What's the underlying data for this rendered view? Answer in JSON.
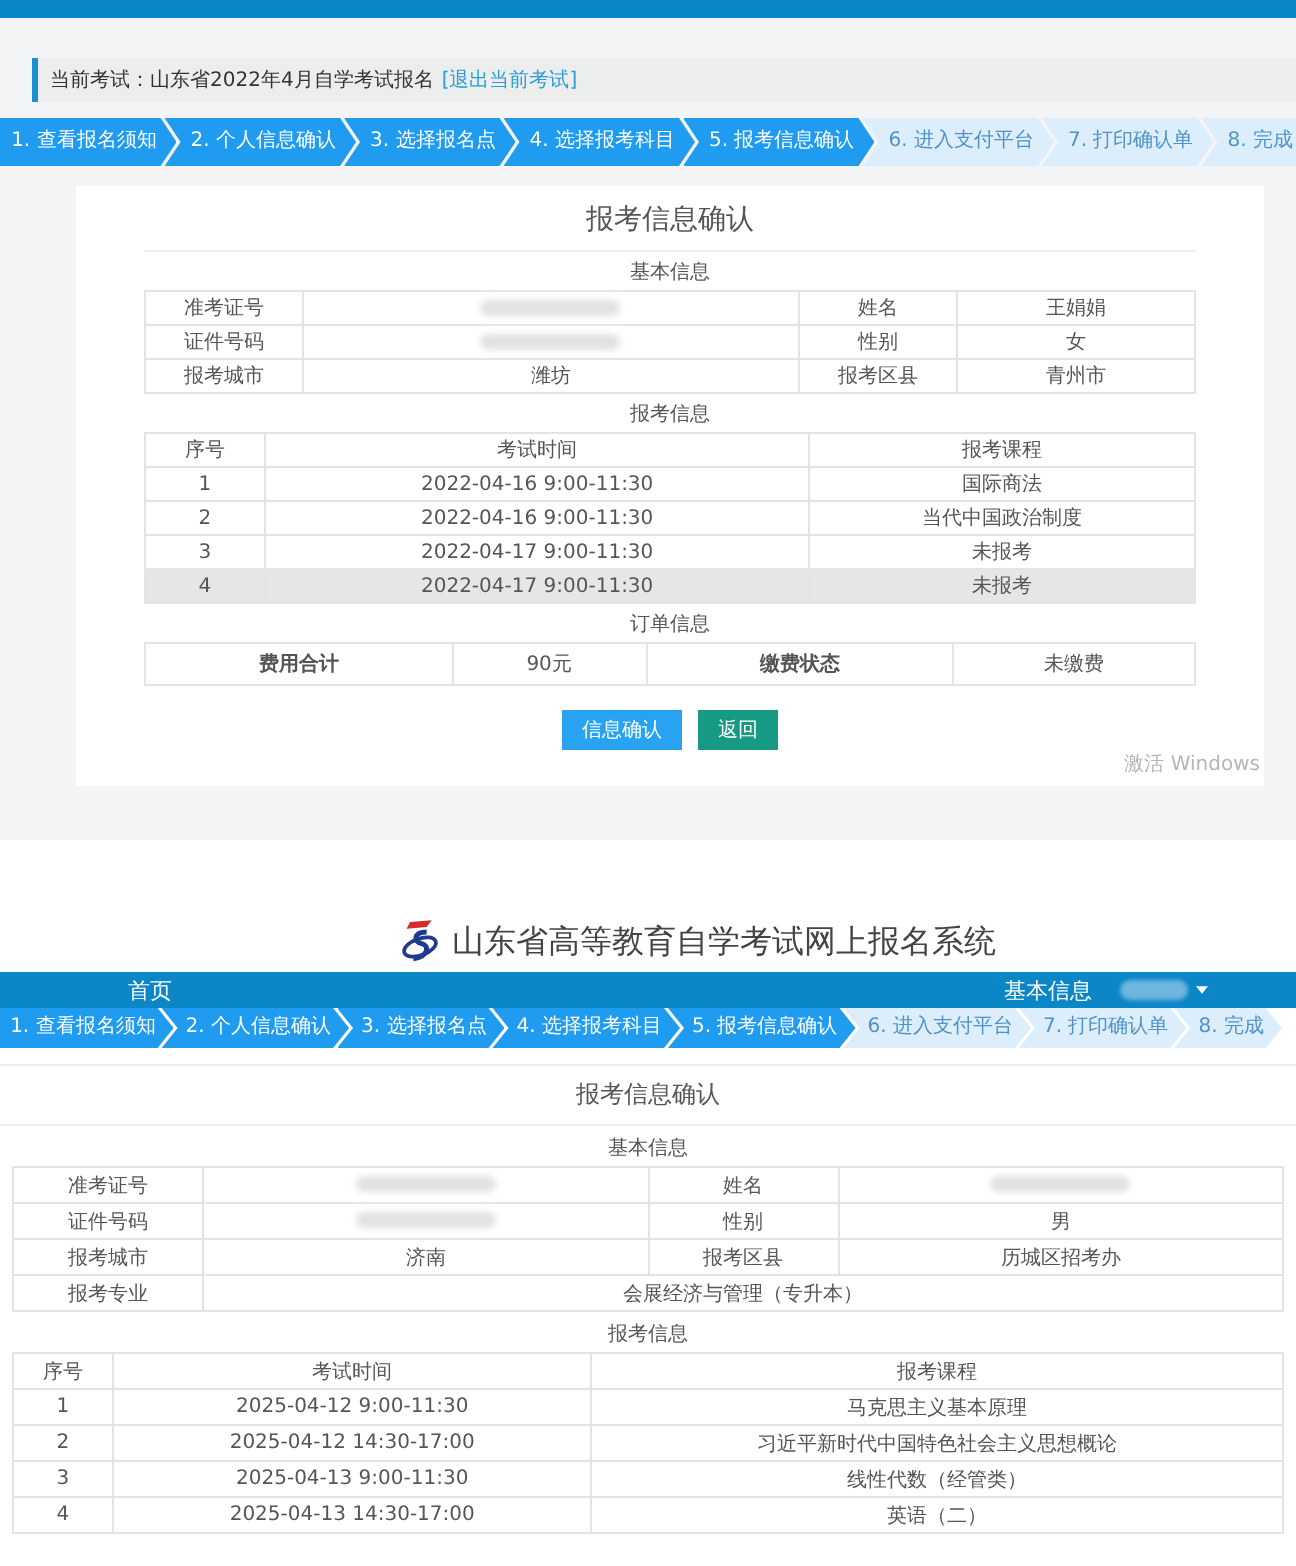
{
  "old_screen": {
    "current_exam": {
      "label": "当前考试：山东省2022年4月自学考试报名",
      "exit_link": "[退出当前考试]"
    },
    "steps": [
      {
        "label": "1. 查看报名须知",
        "done": true
      },
      {
        "label": "2. 个人信息确认",
        "done": true
      },
      {
        "label": "3. 选择报名点",
        "done": true
      },
      {
        "label": "4. 选择报考科目",
        "done": true
      },
      {
        "label": "5. 报考信息确认",
        "done": true
      },
      {
        "label": "6. 进入支付平台",
        "done": false
      },
      {
        "label": "7. 打印确认单",
        "done": false
      },
      {
        "label": "8. 完成",
        "done": false
      }
    ],
    "title": "报考信息确认",
    "basic_info": {
      "heading": "基本信息",
      "rows": [
        [
          {
            "kind": "label",
            "text": "准考证号"
          },
          {
            "kind": "redacted"
          },
          {
            "kind": "label",
            "text": "姓名"
          },
          {
            "kind": "value",
            "text": "王娟娟"
          }
        ],
        [
          {
            "kind": "label",
            "text": "证件号码"
          },
          {
            "kind": "redacted"
          },
          {
            "kind": "label",
            "text": "性别"
          },
          {
            "kind": "value",
            "text": "女"
          }
        ],
        [
          {
            "kind": "label",
            "text": "报考城市"
          },
          {
            "kind": "value",
            "text": "潍坊"
          },
          {
            "kind": "label",
            "text": "报考区县"
          },
          {
            "kind": "value",
            "text": "青州市"
          }
        ]
      ]
    },
    "exam_info": {
      "heading": "报考信息",
      "columns": [
        "序号",
        "考试时间",
        "报考课程"
      ],
      "rows": [
        {
          "cells": [
            "1",
            "2022-04-16 9:00-11:30",
            "国际商法"
          ],
          "selected": false
        },
        {
          "cells": [
            "2",
            "2022-04-16 9:00-11:30",
            "当代中国政治制度"
          ],
          "selected": false
        },
        {
          "cells": [
            "3",
            "2022-04-17 9:00-11:30",
            "未报考"
          ],
          "selected": false
        },
        {
          "cells": [
            "4",
            "2022-04-17 9:00-11:30",
            "未报考"
          ],
          "selected": true
        }
      ]
    },
    "order_info": {
      "heading": "订单信息",
      "cells": [
        "费用合计",
        "90元",
        "缴费状态",
        "未缴费"
      ]
    },
    "buttons": [
      {
        "label": "信息确认",
        "kind": "primary"
      },
      {
        "label": "返回",
        "kind": "secondary"
      }
    ],
    "os_notice": "激活 Windows"
  },
  "new_screen": {
    "site_title": "山东省高等教育自学考试网上报名系统",
    "nav": {
      "home": "首页",
      "account": "基本信息"
    },
    "steps": [
      {
        "label": "1. 查看报名须知",
        "done": true
      },
      {
        "label": "2. 个人信息确认",
        "done": true
      },
      {
        "label": "3. 选择报名点",
        "done": true
      },
      {
        "label": "4. 选择报考科目",
        "done": true
      },
      {
        "label": "5. 报考信息确认",
        "done": true
      },
      {
        "label": "6. 进入支付平台",
        "done": false
      },
      {
        "label": "7. 打印确认单",
        "done": false
      },
      {
        "label": "8. 完成",
        "done": false
      }
    ],
    "title": "报考信息确认",
    "basic_info": {
      "heading": "基本信息",
      "rows": [
        [
          {
            "kind": "label",
            "text": "准考证号"
          },
          {
            "kind": "redacted"
          },
          {
            "kind": "label",
            "text": "姓名"
          },
          {
            "kind": "redacted"
          }
        ],
        [
          {
            "kind": "label",
            "text": "证件号码"
          },
          {
            "kind": "redacted"
          },
          {
            "kind": "label",
            "text": "性别"
          },
          {
            "kind": "value",
            "text": "男"
          }
        ],
        [
          {
            "kind": "label",
            "text": "报考城市"
          },
          {
            "kind": "value",
            "text": "济南"
          },
          {
            "kind": "label",
            "text": "报考区县"
          },
          {
            "kind": "value",
            "text": "历城区招考办"
          }
        ],
        [
          {
            "kind": "label",
            "text": "报考专业"
          },
          {
            "kind": "value",
            "text": "会展经济与管理（专升本）",
            "colspan": 3
          }
        ]
      ]
    },
    "exam_info": {
      "heading": "报考信息",
      "columns": [
        "序号",
        "考试时间",
        "报考课程"
      ],
      "rows": [
        {
          "cells": [
            "1",
            "2025-04-12 9:00-11:30",
            "马克思主义基本原理"
          ],
          "selected": false
        },
        {
          "cells": [
            "2",
            "2025-04-12 14:30-17:00",
            "习近平新时代中国特色社会主义思想概论"
          ],
          "selected": false
        },
        {
          "cells": [
            "3",
            "2025-04-13 9:00-11:30",
            "线性代数（经管类）"
          ],
          "selected": false
        },
        {
          "cells": [
            "4",
            "2025-04-13 14:30-17:00",
            "英语（二）"
          ],
          "selected": false
        }
      ]
    }
  }
}
